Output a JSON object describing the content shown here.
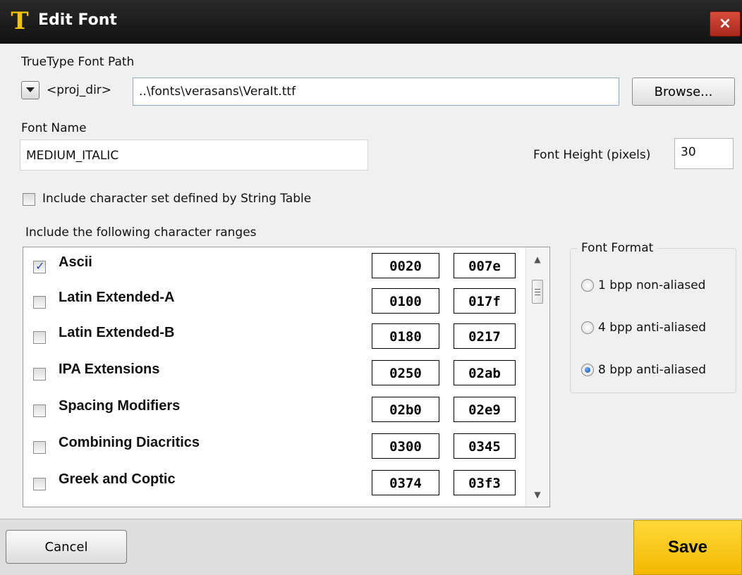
{
  "window": {
    "title": "Edit Font",
    "app_icon": "T",
    "close_label": "×"
  },
  "font_path": {
    "label": "TrueType Font Path",
    "prefix": "<proj_dir>",
    "value": "..\\fonts\\verasans\\VeraIt.ttf",
    "browse_label": "Browse..."
  },
  "font_name": {
    "label": "Font Name",
    "value": "MEDIUM_ITALIC"
  },
  "font_height": {
    "label": "Font Height (pixels)",
    "value": "30"
  },
  "string_table": {
    "label": "Include character set defined by String Table",
    "checked": false
  },
  "ranges": {
    "label": "Include the following character ranges",
    "items": [
      {
        "name": "Ascii",
        "start": "0020",
        "end": "007e",
        "checked": true
      },
      {
        "name": "Latin Extended-A",
        "start": "0100",
        "end": "017f",
        "checked": false
      },
      {
        "name": "Latin Extended-B",
        "start": "0180",
        "end": "0217",
        "checked": false
      },
      {
        "name": "IPA Extensions",
        "start": "0250",
        "end": "02ab",
        "checked": false
      },
      {
        "name": "Spacing Modifiers",
        "start": "02b0",
        "end": "02e9",
        "checked": false
      },
      {
        "name": "Combining Diacritics",
        "start": "0300",
        "end": "0345",
        "checked": false
      },
      {
        "name": "Greek and Coptic",
        "start": "0374",
        "end": "03f3",
        "checked": false
      }
    ]
  },
  "font_format": {
    "label": "Font Format",
    "options": [
      {
        "label": "1 bpp non-aliased",
        "selected": false
      },
      {
        "label": "4 bpp anti-aliased",
        "selected": false
      },
      {
        "label": "8 bpp anti-aliased",
        "selected": true
      }
    ]
  },
  "buttons": {
    "cancel": "Cancel",
    "save": "Save"
  },
  "colors": {
    "title_bar": "#1a1a1a",
    "accent_icon": "#f5c400",
    "close": "#c0392b",
    "save": "#f7c51a"
  }
}
